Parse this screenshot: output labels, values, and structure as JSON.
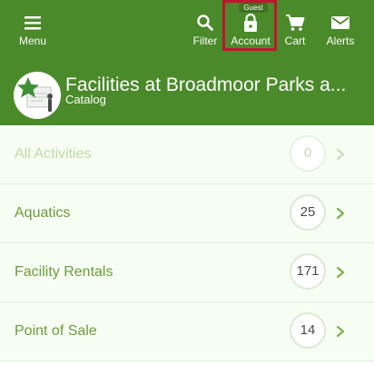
{
  "nav": {
    "menu_label": "Menu",
    "filter_label": "Filter",
    "account_label": "Account",
    "account_badge": "Guest",
    "cart_label": "Cart",
    "alerts_label": "Alerts"
  },
  "header": {
    "title": "Facilities at Broadmoor Parks a...",
    "subtitle": "Catalog"
  },
  "categories": [
    {
      "label": "All Activities",
      "count": "0",
      "disabled": true
    },
    {
      "label": "Aquatics",
      "count": "25",
      "disabled": false
    },
    {
      "label": "Facility Rentals",
      "count": "171",
      "disabled": false
    },
    {
      "label": "Point of Sale",
      "count": "14",
      "disabled": false
    }
  ],
  "icons": {
    "menu": "menu-icon",
    "filter": "search-icon",
    "account": "lock-icon",
    "cart": "cart-icon",
    "alerts": "mail-icon",
    "row_arrow": "chevron-right-icon"
  },
  "colors": {
    "brand_green": "#4a8a2a",
    "highlight_outline": "#c0152f",
    "row_background": "#f6fdf3",
    "row_label": "#6d9c3c"
  }
}
